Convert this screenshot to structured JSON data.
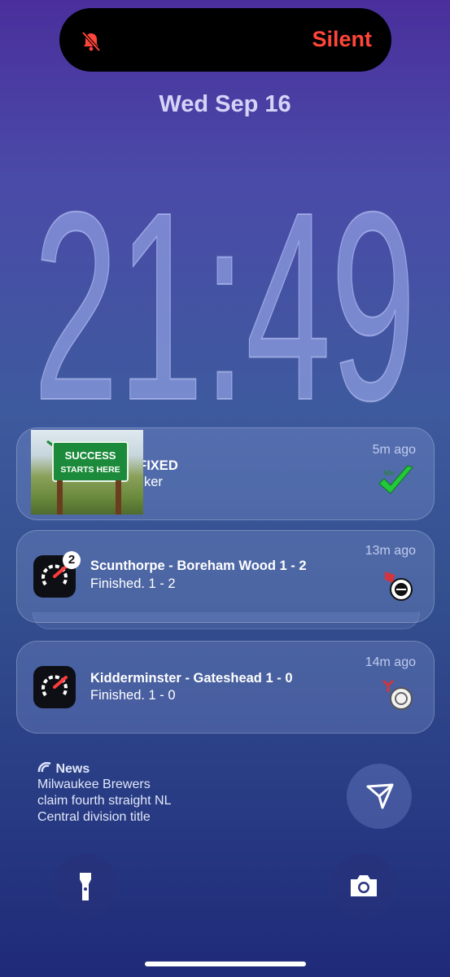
{
  "island": {
    "status_text": "Silent",
    "icon": "bell-slash-icon"
  },
  "lockscreen": {
    "date": "Wed Sep 16",
    "time": "21:49"
  },
  "notifications": [
    {
      "time_ago": "5m ago",
      "image_text": {
        "line1": "SUCCESS",
        "line2": "STARTS HERE"
      },
      "title_emoji": "💯",
      "title": "FIXED",
      "body": "ker",
      "attachment_label": "Win"
    },
    {
      "time_ago": "13m ago",
      "badge": "2",
      "title": "Scunthorpe - Boreham Wood 1 - 2",
      "body": "Finished. 1 - 2"
    },
    {
      "time_ago": "14m ago",
      "title": "Kidderminster - Gateshead 1 - 0",
      "body": "Finished. 1 - 0"
    }
  ],
  "news_widget": {
    "header": "News",
    "headline_lines": [
      "Milwaukee Brewers",
      "claim fourth straight NL",
      "Central division title"
    ]
  },
  "colors": {
    "silent_red": "#ff453a",
    "clock_fill": "#8f9ee0",
    "check_green": "#22c93a"
  }
}
